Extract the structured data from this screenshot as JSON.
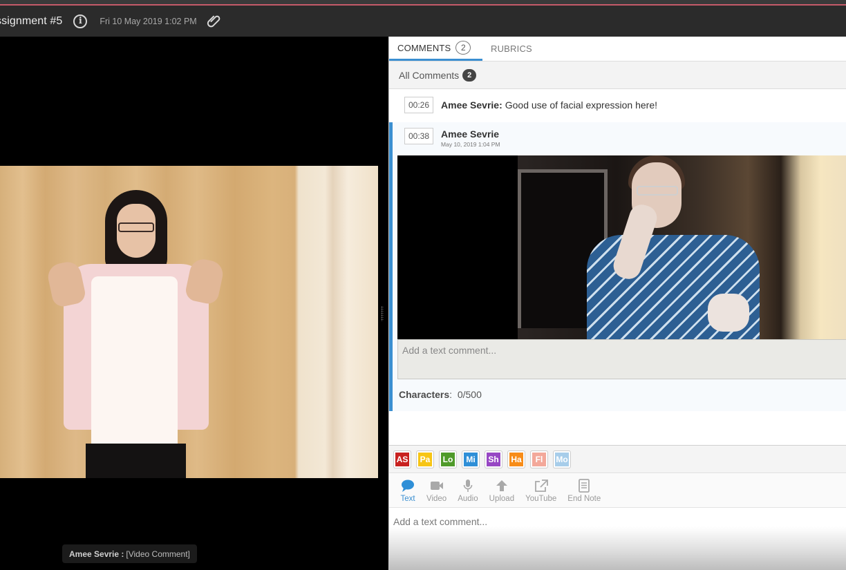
{
  "header": {
    "title": "ssignment #5",
    "date": "Fri 10 May 2019  1:02 PM",
    "info_icon": "info-circle-icon",
    "attachment_icon": "paperclip-icon"
  },
  "player": {
    "caption_author": "Amee Sevrie :",
    "caption_text": "[Video Comment]"
  },
  "tabs": [
    {
      "label": "COMMENTS",
      "count": "2",
      "active": true
    },
    {
      "label": "RUBRICS",
      "active": false
    }
  ],
  "filter": {
    "label": "All Comments",
    "count": "2"
  },
  "comments": [
    {
      "timestamp": "00:26",
      "author": "Amee Sevrie:",
      "text": "Good use of facial expression here!"
    },
    {
      "timestamp": "00:38",
      "author": "Amee Sevrie",
      "date": "May 10, 2019 1:04 PM",
      "type": "video",
      "reply_placeholder": "Add a text comment...",
      "characters_label": "Characters",
      "characters_value": "0/500"
    }
  ],
  "tags": [
    {
      "label": "AS",
      "color": "#c8211f"
    },
    {
      "label": "Pa",
      "color": "#f7c515"
    },
    {
      "label": "Lo",
      "color": "#4f9a2a"
    },
    {
      "label": "Mi",
      "color": "#2f8fd7"
    },
    {
      "label": "Sh",
      "color": "#9747c4"
    },
    {
      "label": "Ha",
      "color": "#f78c18"
    },
    {
      "label": "Fl",
      "color": "#f3a89a"
    },
    {
      "label": "Mo",
      "color": "#a7cdea"
    }
  ],
  "tools": [
    {
      "label": "Text",
      "icon": "speech-bubble-icon",
      "active": true
    },
    {
      "label": "Video",
      "icon": "video-camera-icon",
      "active": false
    },
    {
      "label": "Audio",
      "icon": "microphone-icon",
      "active": false
    },
    {
      "label": "Upload",
      "icon": "upload-arrow-icon",
      "active": false
    },
    {
      "label": "YouTube",
      "icon": "external-link-icon",
      "active": false
    },
    {
      "label": "End Note",
      "icon": "note-icon",
      "active": false
    }
  ],
  "compose": {
    "placeholder": "Add a text comment..."
  },
  "colors": {
    "accent": "#3b8fd1",
    "header_bg": "#2b2b2b",
    "top_border": "#c65b6a"
  }
}
